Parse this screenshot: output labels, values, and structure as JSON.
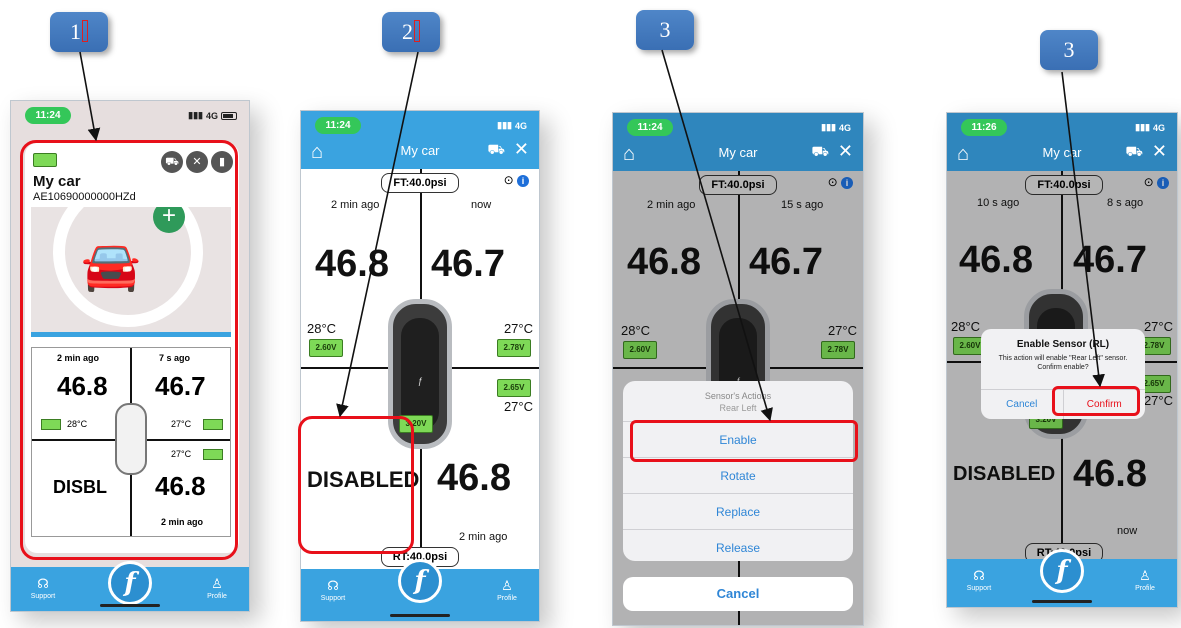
{
  "steps": [
    {
      "label": "1",
      "marked": true
    },
    {
      "label": "2",
      "marked": true
    },
    {
      "label": "3",
      "marked": false
    },
    {
      "label": "3",
      "marked": false
    }
  ],
  "phone1": {
    "time": "11:24",
    "signal": "4G",
    "card": {
      "title": "My car",
      "id": "AE10690000000HZd"
    },
    "grid": {
      "fl_ago": "2 min ago",
      "fr_ago": "7 s ago",
      "fl_value": "46.8",
      "fr_value": "46.7",
      "fl_temp": "28°C",
      "fr_temp": "27°C",
      "rr_temp": "27°C",
      "rl_value": "DISBL",
      "rr_value": "46.8",
      "rr_ago": "2 min ago"
    },
    "tabbar": {
      "support": "Support",
      "profile": "Profile"
    }
  },
  "phone2": {
    "time": "11:24",
    "signal": "4G",
    "title": "My car",
    "front_tag": "FT:40.0psi",
    "rear_tag": "RT:40.0psi",
    "fl_ago": "2 min ago",
    "fr_ago": "now",
    "fl_value": "46.8",
    "fr_value": "46.7",
    "fl_temp": "28°C",
    "fr_temp": "27°C",
    "rr_temp": "27°C",
    "fl_volt": "2.60V",
    "fr_volt": "2.78V",
    "rr_volt": "2.65V",
    "rl_volt": "3.20V",
    "rl_value": "DISABLED",
    "rr_value": "46.8",
    "rr_ago": "2 min ago",
    "tabbar": {
      "support": "Support",
      "profile": "Profile"
    }
  },
  "phone3": {
    "time": "11:24",
    "signal": "4G",
    "title": "My car",
    "front_tag": "FT:40.0psi",
    "fl_ago": "2 min ago",
    "fr_ago": "15 s ago",
    "fl_value": "46.8",
    "fr_value": "46.7",
    "fl_temp": "28°C",
    "fr_temp": "27°C",
    "fl_volt": "2.60V",
    "fr_volt": "2.78V",
    "sheet": {
      "title": "Sensor's Actions",
      "subtitle": "Rear Left",
      "actions": [
        "Enable",
        "Rotate",
        "Replace",
        "Release"
      ],
      "cancel": "Cancel"
    }
  },
  "phone4": {
    "time": "11:26",
    "signal": "4G",
    "title": "My car",
    "front_tag": "FT:40.0psi",
    "rear_tag": "RT:40.0psi",
    "fl_ago": "10 s ago",
    "fr_ago": "8 s ago",
    "fl_value": "46.8",
    "fr_value": "46.7",
    "fl_temp": "28°C",
    "fr_temp": "27°C",
    "rr_temp": "27°C",
    "fl_volt": "2.60V",
    "fr_volt": "2.78V",
    "rr_volt": "2.65V",
    "rl_volt": "3.20V",
    "rl_value": "DISABLED",
    "rr_value": "46.8",
    "rr_ago": "now",
    "dialog": {
      "title": "Enable Sensor (RL)",
      "message": "This action will enable \"Rear Left\" sensor. Confirm enable?",
      "cancel": "Cancel",
      "confirm": "Confirm"
    },
    "tabbar": {
      "support": "Support",
      "profile": "Profile"
    }
  },
  "colors": {
    "accent": "#3aa3e0",
    "highlight": "#e8101a",
    "step_box": "#4a7fc1",
    "battery": "#7ed957"
  }
}
